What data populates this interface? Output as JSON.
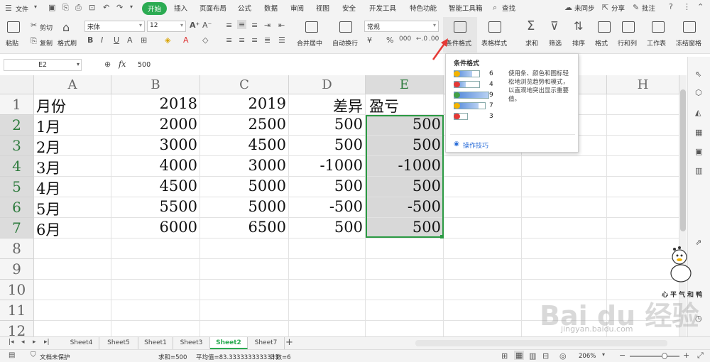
{
  "menubar": {
    "file_label": "文件",
    "tabs": [
      "开始",
      "插入",
      "页面布局",
      "公式",
      "数据",
      "审阅",
      "视图",
      "安全",
      "开发工具",
      "特色功能",
      "智能工具箱"
    ],
    "search_label": "查找",
    "sync_label": "未同步",
    "share_label": "分享",
    "comment_label": "批注"
  },
  "ribbon": {
    "paste": "粘贴",
    "cut": "剪切",
    "copy": "复制",
    "format_painter": "格式刷",
    "font_name": "宋体",
    "font_size": "12",
    "merge_center": "合并居中",
    "wrap_text": "自动换行",
    "number_format": "常规",
    "currency_symbol": "¥",
    "percent_symbol": "%",
    "conditional_format": "条件格式",
    "table_style": "表格样式",
    "sum": "求和",
    "filter": "筛选",
    "sort": "排序",
    "format": "格式",
    "row_col": "行和列",
    "worksheet": "工作表",
    "freeze": "冻结窗格"
  },
  "formula_bar": {
    "name_box": "E2",
    "fx": "fx",
    "value": "500"
  },
  "columns": [
    "A",
    "B",
    "C",
    "D",
    "E",
    "",
    "",
    "H"
  ],
  "rows": [
    "1",
    "2",
    "3",
    "4",
    "5",
    "6",
    "7",
    "8",
    "9",
    "10",
    "11",
    "12"
  ],
  "table": {
    "header": [
      "月份",
      "2018",
      "2019",
      "差异",
      "盈亏"
    ],
    "data": [
      [
        "1月",
        "2000",
        "2500",
        "500",
        "500"
      ],
      [
        "2月",
        "3000",
        "4500",
        "500",
        "500"
      ],
      [
        "3月",
        "4000",
        "3000",
        "-1000",
        "-1000"
      ],
      [
        "4月",
        "4500",
        "5000",
        "500",
        "500"
      ],
      [
        "5月",
        "5500",
        "5000",
        "-500",
        "-500"
      ],
      [
        "6月",
        "6000",
        "6500",
        "500",
        "500"
      ]
    ]
  },
  "popup": {
    "title": "条件格式",
    "bars": [
      "6",
      "4",
      "9",
      "7",
      "3"
    ],
    "description": "使用条、颜色和图标轻松地浏览趋势和模式，以直观地突出显示重要值。",
    "tips_link": "操作技巧"
  },
  "sheet_tabs": [
    "Sheet4",
    "Sheet5",
    "Sheet1",
    "Sheet3",
    "Sheet2",
    "Sheet7"
  ],
  "active_sheet": "Sheet2",
  "status": {
    "doc_protect": "文档未保护",
    "sum": "求和=500",
    "average": "平均值=83.3333333333333",
    "count": "计数=6",
    "zoom": "206%"
  },
  "watermark": {
    "logo": "Bai du 经验",
    "url": "jingyan.baidu.com",
    "sticker_text": "心平气和鸭"
  },
  "colors": {
    "accent_green": "#2bab52",
    "selection_green": "#2b9a43",
    "highlight_gray": "#d8d8d8",
    "arrow_red": "#e53935"
  }
}
